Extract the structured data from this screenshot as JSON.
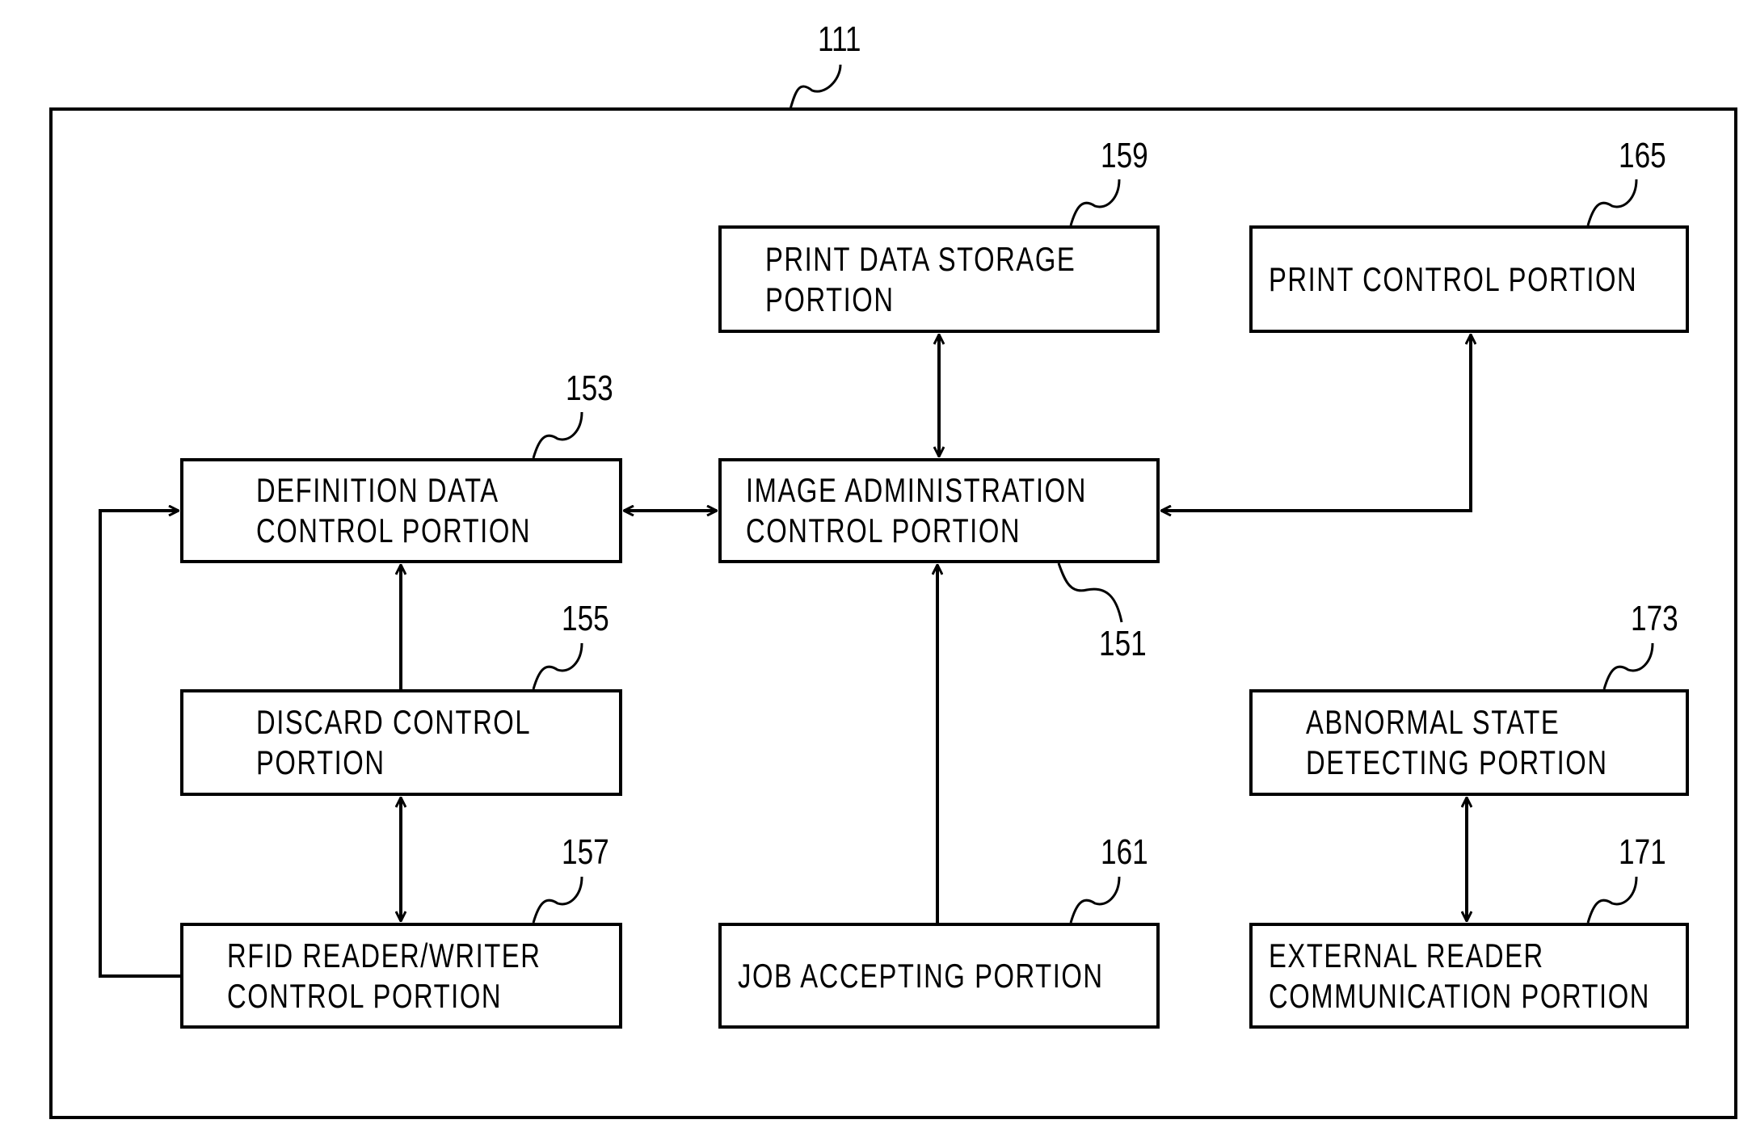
{
  "diagram": {
    "container": {
      "ref": "111"
    },
    "blocks": [
      {
        "id": "159",
        "ref": "159",
        "lines": [
          "PRINT DATA STORAGE",
          "PORTION"
        ]
      },
      {
        "id": "165",
        "ref": "165",
        "lines": [
          "PRINT CONTROL PORTION"
        ]
      },
      {
        "id": "153",
        "ref": "153",
        "lines": [
          "DEFINITION DATA",
          "CONTROL PORTION"
        ]
      },
      {
        "id": "151",
        "ref": "151",
        "lines": [
          "IMAGE ADMINISTRATION",
          "CONTROL PORTION"
        ]
      },
      {
        "id": "155",
        "ref": "155",
        "lines": [
          "DISCARD CONTROL",
          "PORTION"
        ]
      },
      {
        "id": "173",
        "ref": "173",
        "lines": [
          "ABNORMAL STATE",
          "DETECTING PORTION"
        ]
      },
      {
        "id": "157",
        "ref": "157",
        "lines": [
          "RFID READER/WRITER",
          "CONTROL PORTION"
        ]
      },
      {
        "id": "161",
        "ref": "161",
        "lines": [
          "JOB ACCEPTING PORTION"
        ]
      },
      {
        "id": "171",
        "ref": "171",
        "lines": [
          "EXTERNAL READER",
          "COMMUNICATION PORTION"
        ]
      }
    ],
    "connections": [
      {
        "from": "151",
        "to": "159",
        "direction": "bidirectional"
      },
      {
        "from": "151",
        "to": "165",
        "direction": "to-151-and-165"
      },
      {
        "from": "153",
        "to": "151",
        "direction": "bidirectional"
      },
      {
        "from": "155",
        "to": "153",
        "direction": "to-153"
      },
      {
        "from": "155",
        "to": "157",
        "direction": "bidirectional"
      },
      {
        "from": "157",
        "to": "153",
        "direction": "to-153"
      },
      {
        "from": "161",
        "to": "151",
        "direction": "to-151"
      },
      {
        "from": "173",
        "to": "171",
        "direction": "bidirectional"
      }
    ]
  }
}
